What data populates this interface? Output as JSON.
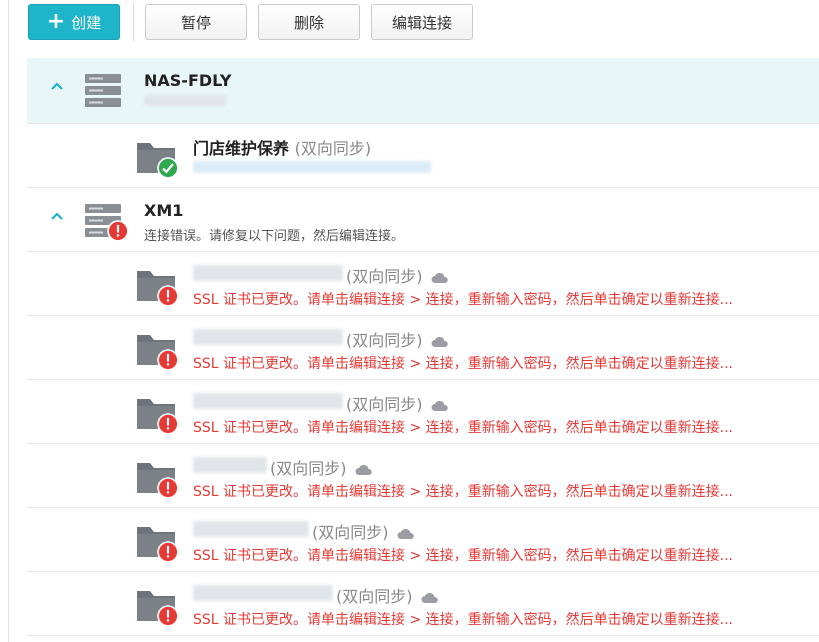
{
  "toolbar": {
    "create_label": "创建",
    "pause_label": "暂停",
    "delete_label": "删除",
    "edit_connection_label": "编辑连接"
  },
  "colors": {
    "accent": "#1fb5c8",
    "error": "#e53935",
    "ok": "#2fa84f",
    "selected_bg": "#e8f6f8"
  },
  "connections": [
    {
      "name": "NAS-FDLY",
      "status": "",
      "icon": "server-icon",
      "tasks": [
        {
          "name": "门店维护保养",
          "sync_mode": "(双向同步)",
          "status_icon": "check-icon",
          "error": ""
        }
      ]
    },
    {
      "name": "XM1",
      "status": "连接错误。请修复以下问题，然后编辑连接。",
      "icon": "server-error-icon",
      "tasks": [
        {
          "name": "",
          "sync_mode": "(双向同步)",
          "status_icon": "error-icon",
          "error": "SSL 证书已更改。请单击编辑连接 > 连接，重新输入密码，然后单击确定以重新连接..."
        },
        {
          "name": "",
          "sync_mode": "(双向同步)",
          "status_icon": "error-icon",
          "error": "SSL 证书已更改。请单击编辑连接 > 连接，重新输入密码，然后单击确定以重新连接..."
        },
        {
          "name": "",
          "sync_mode": "(双向同步)",
          "status_icon": "error-icon",
          "error": "SSL 证书已更改。请单击编辑连接 > 连接，重新输入密码，然后单击确定以重新连接..."
        },
        {
          "name": "",
          "sync_mode": "(双向同步)",
          "status_icon": "error-icon",
          "error": "SSL 证书已更改。请单击编辑连接 > 连接，重新输入密码，然后单击确定以重新连接..."
        },
        {
          "name": "",
          "sync_mode": "(双向同步)",
          "status_icon": "error-icon",
          "error": "SSL 证书已更改。请单击编辑连接 > 连接，重新输入密码，然后单击确定以重新连接..."
        },
        {
          "name": "",
          "sync_mode": "(双向同步)",
          "status_icon": "error-icon",
          "error": "SSL 证书已更改。请单击编辑连接 > 连接，重新输入密码，然后单击确定以重新连接..."
        }
      ]
    }
  ]
}
